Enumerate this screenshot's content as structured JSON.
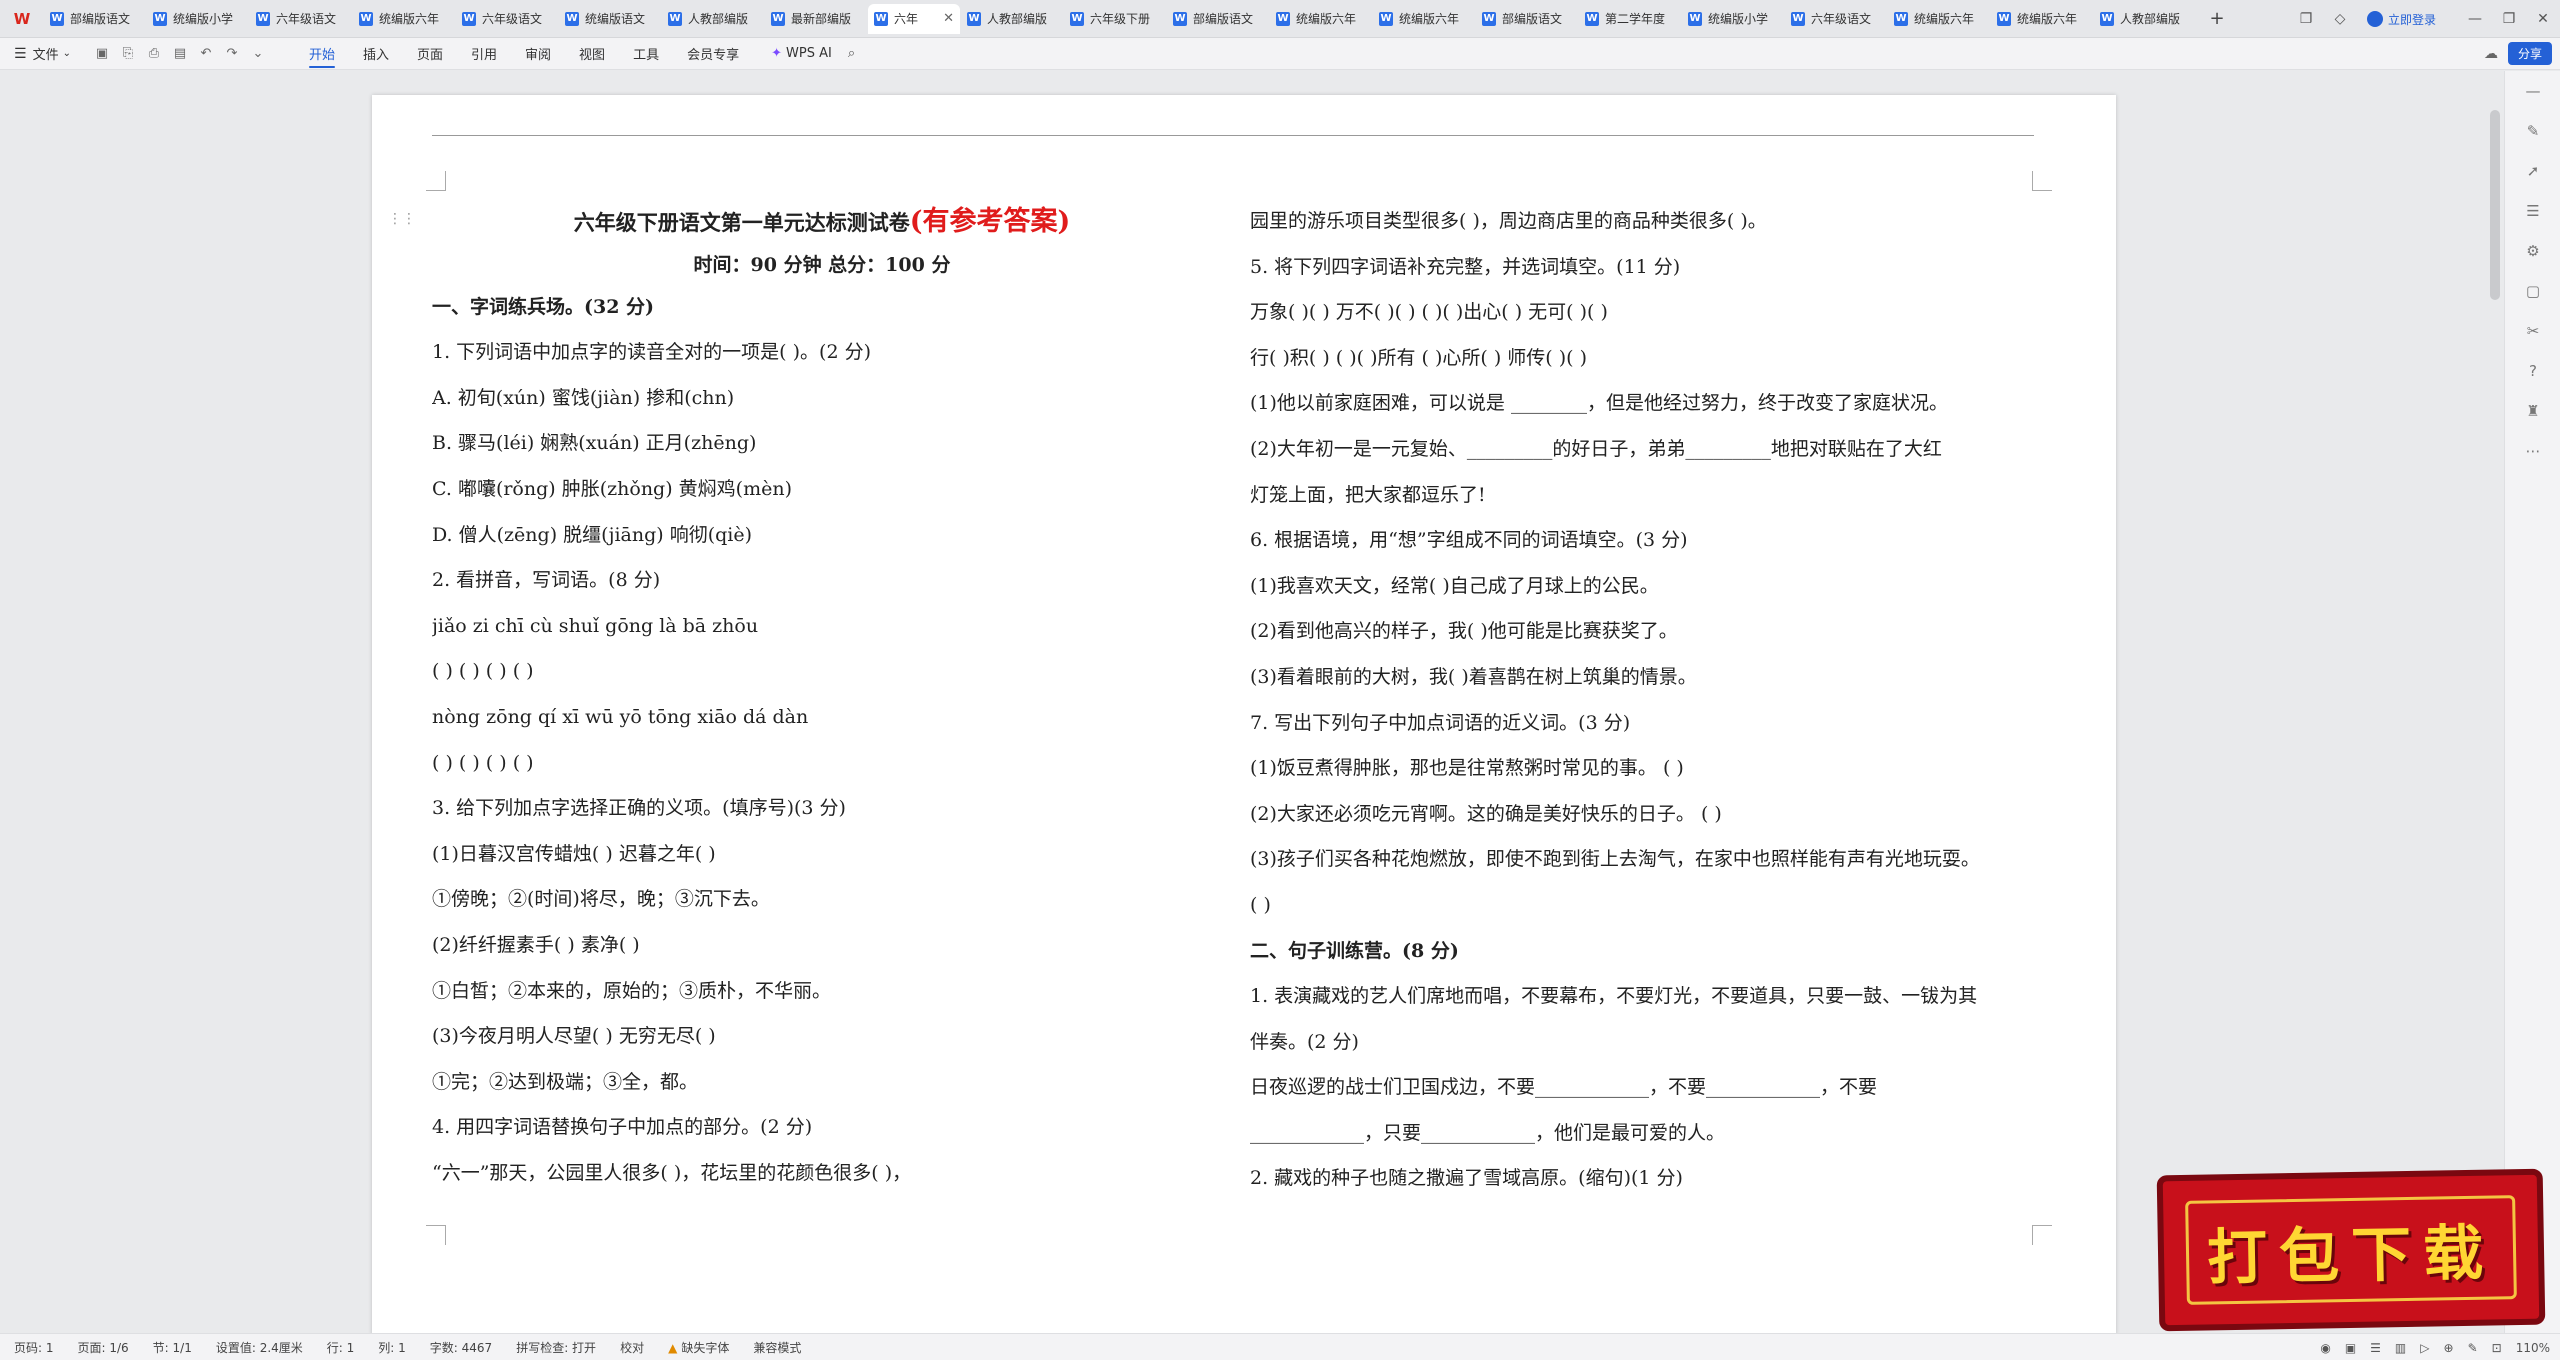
{
  "tabs": [
    {
      "label": "部编版语文"
    },
    {
      "label": "统编版小学"
    },
    {
      "label": "六年级语文"
    },
    {
      "label": "统编版六年"
    },
    {
      "label": "六年级语文"
    },
    {
      "label": "统编版语文"
    },
    {
      "label": "人教部编版"
    },
    {
      "label": "最新部编版"
    },
    {
      "label": "六年",
      "active": true
    },
    {
      "label": "人教部编版"
    },
    {
      "label": "六年级下册"
    },
    {
      "label": "部编版语文"
    },
    {
      "label": "统编版六年"
    },
    {
      "label": "统编版六年"
    },
    {
      "label": "部编版语文"
    },
    {
      "label": "第二学年度"
    },
    {
      "label": "统编版小学"
    },
    {
      "label": "六年级语文"
    },
    {
      "label": "统编版六年"
    },
    {
      "label": "统编版六年"
    },
    {
      "label": "人教部编版"
    }
  ],
  "tab_icon_letter": "W",
  "login_label": "立即登录",
  "toolbar": {
    "file_label": "文件",
    "menus": [
      "开始",
      "插入",
      "页面",
      "引用",
      "审阅",
      "视图",
      "工具",
      "会员专享"
    ],
    "active_menu": "开始",
    "wps_ai": "WPS AI",
    "share_label": "分享"
  },
  "doc": {
    "title": "六年级下册语文第一单元达标测试卷",
    "title_tag": "(有参考答案)",
    "subtitle": "时间：90 分钟   总分：100 分",
    "left": [
      "一、字词练兵场。(32 分)",
      "1. 下列词语中加点字的读音全对的一项是(     )。(2 分)",
      "A. 初旬(xún)           蜜饯(jiàn)           掺和(chn)",
      "B. 骤马(léi)           娴熟(xuán)           正月(zhēng)",
      "C. 嘟囔(rǒng)          肿胀(zhǒng)          黄焖鸡(mèn)",
      "D. 僧人(zēng)          脱缰(jiāng)          响彻(qiè)",
      "2. 看拼音，写词语。(8 分)",
      "  jiǎo zi          chī cù          shuǐ gōng          là bā zhōu",
      "(          )      (          )      (          )      (            )",
      "  nòng zōng          qí xī          wū yō          tōng xiāo dá dàn",
      "(          )      (          )      (          )      (                  )",
      "3. 给下列加点字选择正确的义项。(填序号)(3 分)",
      "(1)日暮汉宫传蜡烛(     )      迟暮之年(     )",
      "①傍晚；②(时间)将尽，晚；③沉下去。",
      "(2)纤纤握素手(     )          素净(     )",
      "①白皙；②本来的，原始的；③质朴，不华丽。",
      "(3)今夜月明人尽望(     )      无穷无尽(     )",
      "①完；②达到极端；③全，都。",
      "4. 用四字词语替换句子中加点的部分。(2 分)",
      "    “六一”那天，公园里人很多(          )，花坛里的花颜色很多(            )，"
    ],
    "right": [
      "园里的游乐项目类型很多(          )，周边商店里的商品种类很多(            )。",
      "5. 将下列四字词语补充完整，并选词填空。(11 分)",
      "万象(   )(   )    万不(   )(   )    (   )(   )出心(   )    无可(   )(   )",
      "行(   )积(   )    (   )(   )所有    (   )心所(   )    师传(   )(   )",
      "(1)他以前家庭困难，可以说是 ________，但是他经过努力，终于改变了家庭状况。",
      "(2)大年初一是一元复始、_________的好日子，弟弟_________地把对联贴在了大红",
      "灯笼上面，把大家都逗乐了!",
      "6. 根据语境，用“想”字组成不同的词语填空。(3 分)",
      "(1)我喜欢天文，经常(        )自己成了月球上的公民。",
      "(2)看到他高兴的样子，我(        )他可能是比赛获奖了。",
      "(3)看着眼前的大树，我(        )着喜鹊在树上筑巢的情景。",
      "7. 写出下列句子中加点词语的近义词。(3 分)",
      "(1)饭豆煮得肿胀，那也是往常熬粥时常见的事。              (          )",
      "(2)大家还必须吃元宵啊。这的确是美好快乐的日子。          (          )",
      "(3)孩子们买各种花炮燃放，即使不跑到街上去淘气，在家中也照样能有声有光地玩耍。",
      "(          )",
      "二、句子训练营。(8 分)",
      "1. 表演藏戏的艺人们席地而唱，不要幕布，不要灯光，不要道具，只要一鼓、一钹为其",
      "伴奏。(2 分)",
      "    日夜巡逻的战士们卫国戍边，不要____________，不要____________，不要",
      "____________，只要____________，他们是最可爱的人。",
      "2. 藏戏的种子也随之撒遍了雪域高原。(缩句)(1 分)"
    ]
  },
  "status": {
    "page": "页码: 1",
    "pages": "页面: 1/6",
    "section": "节: 1/1",
    "setting": "设置值: 2.4厘米",
    "row": "行: 1",
    "col": "列: 1",
    "words": "字数: 4467",
    "spell": "拼写检查: 打开",
    "proof": "校对",
    "font_missing": "缺失字体",
    "compat": "兼容模式",
    "zoom": "110%"
  },
  "watermark": "打包下载"
}
